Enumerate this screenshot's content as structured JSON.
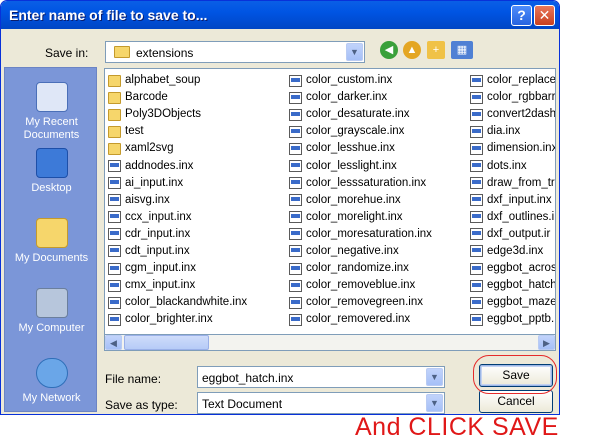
{
  "dialog": {
    "title": "Enter name of file to save to...",
    "help_glyph": "?",
    "close_glyph": "✕"
  },
  "save_in": {
    "label": "Save in:",
    "value": "extensions"
  },
  "places": [
    {
      "label": "My Recent Documents",
      "icon": "recent-documents-icon"
    },
    {
      "label": "Desktop",
      "icon": "desktop-icon"
    },
    {
      "label": "My Documents",
      "icon": "my-documents-icon"
    },
    {
      "label": "My Computer",
      "icon": "my-computer-icon"
    },
    {
      "label": "My Network",
      "icon": "my-network-icon"
    }
  ],
  "files": {
    "col1": [
      {
        "name": "alphabet_soup",
        "type": "folder"
      },
      {
        "name": "Barcode",
        "type": "folder"
      },
      {
        "name": "Poly3DObjects",
        "type": "folder"
      },
      {
        "name": "test",
        "type": "folder"
      },
      {
        "name": "xaml2svg",
        "type": "folder"
      },
      {
        "name": "addnodes.inx",
        "type": "file"
      },
      {
        "name": "ai_input.inx",
        "type": "file"
      },
      {
        "name": "aisvg.inx",
        "type": "file"
      },
      {
        "name": "ccx_input.inx",
        "type": "file"
      },
      {
        "name": "cdr_input.inx",
        "type": "file"
      },
      {
        "name": "cdt_input.inx",
        "type": "file"
      },
      {
        "name": "cgm_input.inx",
        "type": "file"
      },
      {
        "name": "cmx_input.inx",
        "type": "file"
      },
      {
        "name": "color_blackandwhite.inx",
        "type": "file"
      },
      {
        "name": "color_brighter.inx",
        "type": "file"
      }
    ],
    "col2": [
      {
        "name": "color_custom.inx",
        "type": "file"
      },
      {
        "name": "color_darker.inx",
        "type": "file"
      },
      {
        "name": "color_desaturate.inx",
        "type": "file"
      },
      {
        "name": "color_grayscale.inx",
        "type": "file"
      },
      {
        "name": "color_lesshue.inx",
        "type": "file"
      },
      {
        "name": "color_lesslight.inx",
        "type": "file"
      },
      {
        "name": "color_lesssaturation.inx",
        "type": "file"
      },
      {
        "name": "color_morehue.inx",
        "type": "file"
      },
      {
        "name": "color_morelight.inx",
        "type": "file"
      },
      {
        "name": "color_moresaturation.inx",
        "type": "file"
      },
      {
        "name": "color_negative.inx",
        "type": "file"
      },
      {
        "name": "color_randomize.inx",
        "type": "file"
      },
      {
        "name": "color_removeblue.inx",
        "type": "file"
      },
      {
        "name": "color_removegreen.inx",
        "type": "file"
      },
      {
        "name": "color_removered.inx",
        "type": "file"
      }
    ],
    "col3": [
      {
        "name": "color_replace",
        "type": "file"
      },
      {
        "name": "color_rgbbarr",
        "type": "file"
      },
      {
        "name": "convert2dash",
        "type": "file"
      },
      {
        "name": "dia.inx",
        "type": "file"
      },
      {
        "name": "dimension.inx",
        "type": "file"
      },
      {
        "name": "dots.inx",
        "type": "file"
      },
      {
        "name": "draw_from_tr",
        "type": "file"
      },
      {
        "name": "dxf_input.inx",
        "type": "file"
      },
      {
        "name": "dxf_outlines.i",
        "type": "file"
      },
      {
        "name": "dxf_output.ir",
        "type": "file"
      },
      {
        "name": "edge3d.inx",
        "type": "file"
      },
      {
        "name": "eggbot_acros",
        "type": "file"
      },
      {
        "name": "eggbot_hatch",
        "type": "file"
      },
      {
        "name": "eggbot_maze",
        "type": "file"
      },
      {
        "name": "eggbot_pptb.",
        "type": "file"
      }
    ]
  },
  "file_name": {
    "label": "File name:",
    "value": "eggbot_hatch.inx"
  },
  "save_as_type": {
    "label": "Save as type:",
    "value": "Text Document"
  },
  "buttons": {
    "save": "Save",
    "cancel": "Cancel"
  },
  "overlay": {
    "text": "And CLICK SAVE",
    "color": "#e01818"
  },
  "colors": {
    "titlebar": "#0054e3",
    "dialog_bg": "#ece9d8",
    "places_bar": "#7b96d8"
  }
}
